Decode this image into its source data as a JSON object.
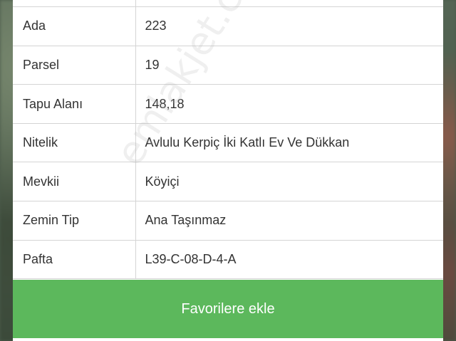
{
  "rows": [
    {
      "key": "",
      "value": ""
    },
    {
      "key": "Ada",
      "value": "223"
    },
    {
      "key": "Parsel",
      "value": "19"
    },
    {
      "key": "Tapu Alanı",
      "value": "148,18"
    },
    {
      "key": "Nitelik",
      "value": "Avlulu Kerpiç İki Katlı Ev Ve Dükkan"
    },
    {
      "key": "Mevkii",
      "value": "Köyiçi"
    },
    {
      "key": "Zemin Tip",
      "value": "Ana Taşınmaz"
    },
    {
      "key": "Pafta",
      "value": "L39-C-08-D-4-A"
    }
  ],
  "actions": {
    "favorite_label": "Favorilere ekle"
  },
  "watermark": "emlakjet.com",
  "colors": {
    "button": "#5cb85c",
    "text": "#333333",
    "border": "#d4d4d4"
  }
}
